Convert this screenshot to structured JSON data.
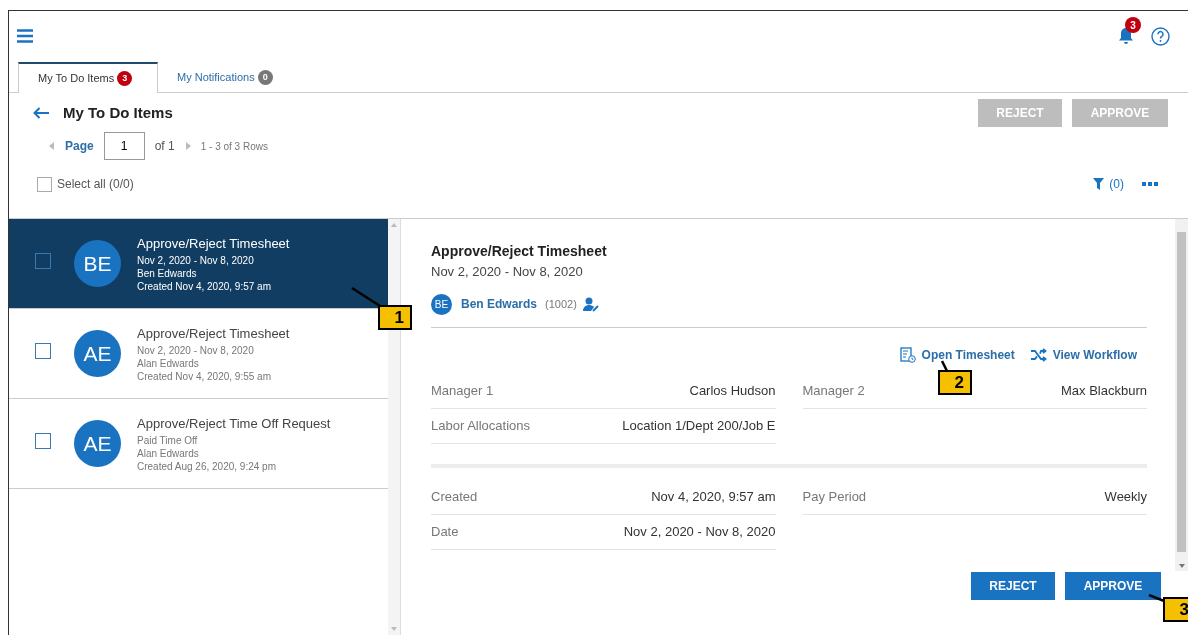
{
  "header": {
    "notification_count": "3"
  },
  "tabs": [
    {
      "label": "My To Do Items",
      "count": "3",
      "selected": true
    },
    {
      "label": "My Notifications",
      "count": "0",
      "selected": false
    }
  ],
  "page_title": "My To Do Items",
  "top_actions": [
    {
      "label": "REJECT",
      "disabled": true
    },
    {
      "label": "APPROVE",
      "disabled": true
    }
  ],
  "pagination": {
    "label": "Page",
    "value": "1",
    "of": "of 1",
    "rows": "1 - 3 of 3 Rows"
  },
  "select_all": {
    "label": "Select all (0/0)",
    "checked": false
  },
  "filter": {
    "label": "(0)"
  },
  "items": [
    {
      "initials": "BE",
      "title": "Approve/Reject Timesheet",
      "lines": [
        "Nov 2, 2020 - Nov 8, 2020",
        "Ben Edwards",
        "Created Nov 4, 2020, 9:57 am"
      ],
      "selected": true,
      "checked": false
    },
    {
      "initials": "AE",
      "title": "Approve/Reject Timesheet",
      "lines": [
        "Nov 2, 2020 - Nov 8, 2020",
        "Alan Edwards",
        "Created Nov 4, 2020, 9:55 am"
      ],
      "selected": false,
      "checked": false
    },
    {
      "initials": "AE",
      "title": "Approve/Reject Time Off Request",
      "lines": [
        "Paid Time Off",
        "Alan Edwards",
        "Created Aug 26, 2020, 9:24 pm"
      ],
      "selected": false,
      "checked": false
    }
  ],
  "detail": {
    "title": "Approve/Reject Timesheet",
    "subtitle": "Nov 2, 2020 - Nov 8, 2020",
    "person": {
      "initials": "BE",
      "name": "Ben Edwards",
      "id": "(1002)"
    },
    "links": [
      {
        "kind": "timesheet",
        "label": "Open Timesheet"
      },
      {
        "kind": "workflow",
        "label": "View Workflow"
      }
    ],
    "sections": [
      {
        "left": [
          {
            "label": "Manager 1",
            "value": "Carlos Hudson"
          },
          {
            "label": "Labor Allocations",
            "value": "Location 1/Dept 200/Job E"
          }
        ],
        "right": [
          {
            "label": "Manager 2",
            "value": "Max Blackburn"
          }
        ]
      },
      {
        "left": [
          {
            "label": "Created",
            "value": "Nov 4, 2020, 9:57 am"
          },
          {
            "label": "Date",
            "value": "Nov 2, 2020 - Nov 8, 2020"
          }
        ],
        "right": [
          {
            "label": "Pay Period",
            "value": "Weekly"
          }
        ]
      }
    ],
    "buttons": [
      {
        "label": "REJECT",
        "disabled": false
      },
      {
        "label": "APPROVE",
        "disabled": false
      }
    ]
  },
  "callouts": [
    {
      "label": "1"
    },
    {
      "label": "2"
    },
    {
      "label": "3"
    }
  ]
}
